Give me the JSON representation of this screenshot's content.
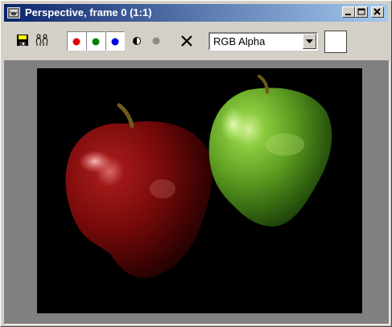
{
  "window": {
    "title": "Perspective, frame 0 (1:1)",
    "title_icon": "teapot-render-icon",
    "caption_buttons": [
      "minimize",
      "maximize",
      "close"
    ]
  },
  "toolbar": {
    "save_icon": "floppy-save-icon",
    "clone_icon": "clone-window-icon",
    "channels": [
      {
        "name": "red-channel",
        "color": "#e00000",
        "active": true
      },
      {
        "name": "green-channel",
        "color": "#008000",
        "active": true
      },
      {
        "name": "blue-channel",
        "color": "#0000e0",
        "active": true
      },
      {
        "name": "mono-channel",
        "color": "#000000",
        "active": false
      },
      {
        "name": "alpha-channel",
        "color": "#8c8c8c",
        "active": false
      }
    ],
    "clear_icon": "clear-x-icon",
    "channel_select": {
      "value": "RGB Alpha"
    },
    "swatch_color": "#ffffff"
  },
  "render": {
    "background": "#000000",
    "subject": "red-and-green-apples"
  }
}
